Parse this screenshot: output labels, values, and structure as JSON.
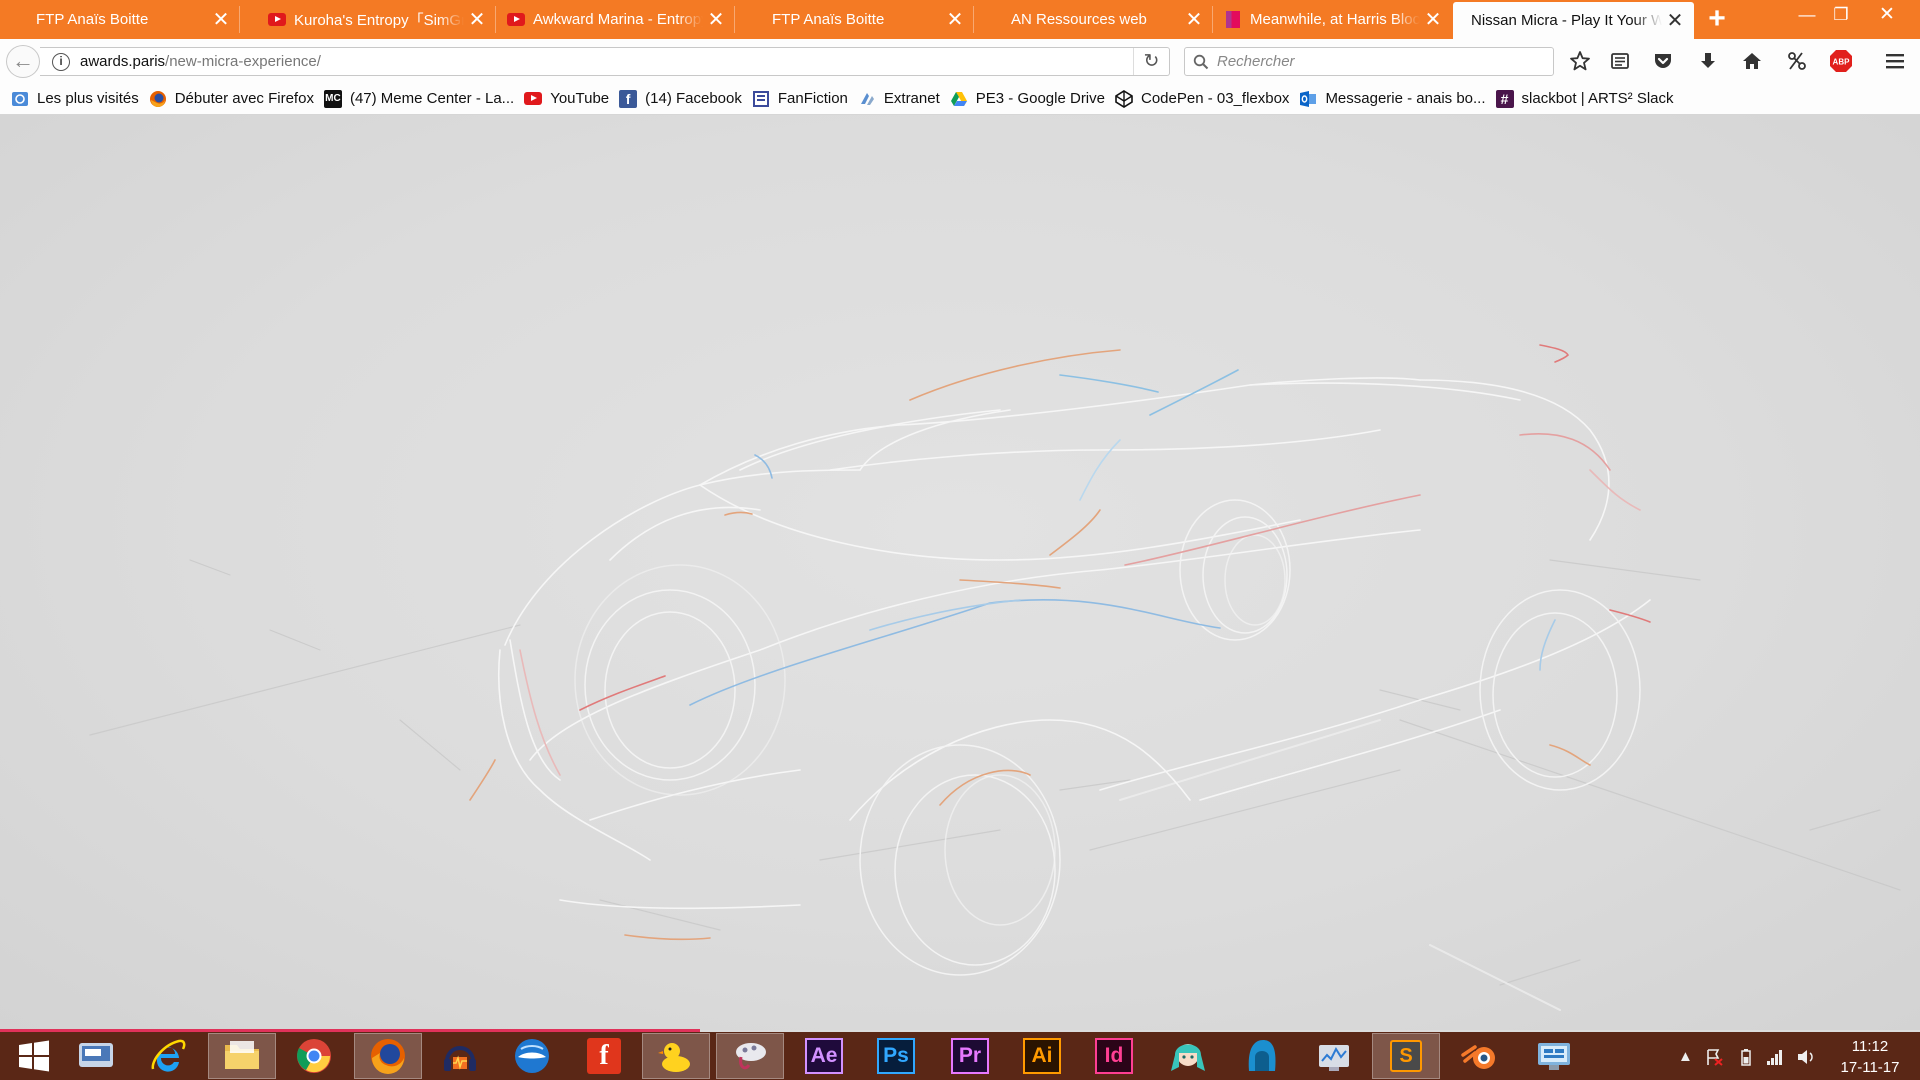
{
  "tabs": [
    {
      "title": "FTP Anaïs Boitte",
      "icon": "none",
      "active": false
    },
    {
      "title": "Kuroha's Entropy「SimGretina」",
      "icon": "youtube-icon",
      "active": false
    },
    {
      "title": "Awkward Marina - Entropy",
      "icon": "youtube-icon",
      "active": false
    },
    {
      "title": "FTP Anaïs Boitte",
      "icon": "none",
      "active": false
    },
    {
      "title": "AN Ressources web",
      "icon": "none",
      "active": false
    },
    {
      "title": "Meanwhile, at Harris Bloom",
      "icon": "bloomberg-icon",
      "active": false
    },
    {
      "title": "Nissan Micra - Play It Your Way",
      "icon": "none",
      "active": true
    }
  ],
  "address": {
    "host": "awards.paris",
    "path": "/new-micra-experience/"
  },
  "search": {
    "placeholder": "Rechercher"
  },
  "bookmarks": [
    {
      "label": "Les plus visités",
      "icon": "most-visited-icon"
    },
    {
      "label": "Débuter avec Firefox",
      "icon": "firefox-icon"
    },
    {
      "label": "(47) Meme Center - La...",
      "icon": "memecenter-icon"
    },
    {
      "label": "YouTube",
      "icon": "youtube-icon"
    },
    {
      "label": "(14) Facebook",
      "icon": "facebook-icon"
    },
    {
      "label": "FanFiction",
      "icon": "fanfiction-icon"
    },
    {
      "label": "Extranet",
      "icon": "extranet-icon"
    },
    {
      "label": "PE3 - Google Drive",
      "icon": "google-drive-icon"
    },
    {
      "label": "CodePen - 03_flexbox",
      "icon": "codepen-icon"
    },
    {
      "label": "Messagerie - anais bo...",
      "icon": "outlook-icon"
    },
    {
      "label": "slackbot | ARTS² Slack",
      "icon": "slack-icon"
    }
  ],
  "taskbar": {
    "adobe": {
      "ae": "Ae",
      "ps": "Ps",
      "pr": "Pr",
      "ai": "Ai",
      "id": "Id"
    },
    "fontforge": "f",
    "sublime": "S"
  },
  "abp_label": "ABP",
  "memecenter_label": "MC",
  "slack_label": "#",
  "clock": {
    "time": "11:12",
    "date": "17-11-17"
  },
  "colors": {
    "firefox_orange": "#f47a24",
    "taskbar": "#5a2716",
    "loading_bar": "#e0325a"
  }
}
